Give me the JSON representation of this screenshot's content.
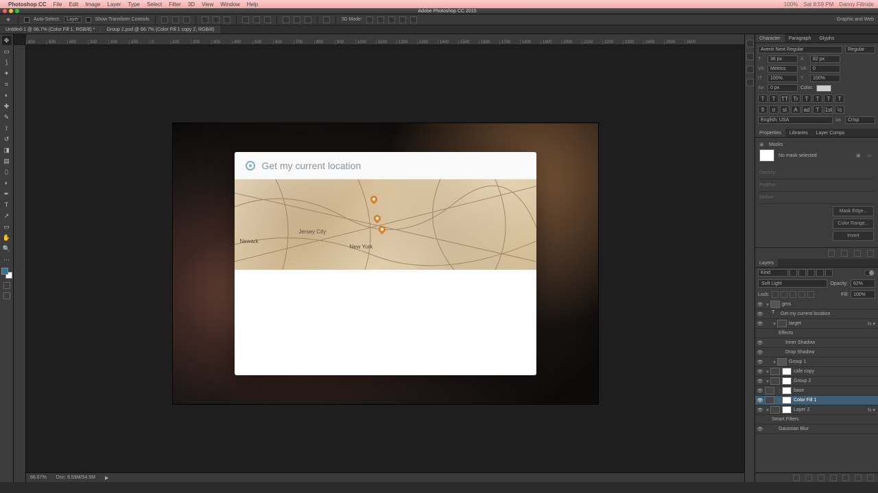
{
  "mac": {
    "app": "Photoshop CC",
    "menus": [
      "File",
      "Edit",
      "Image",
      "Layer",
      "Type",
      "Select",
      "Filter",
      "3D",
      "View",
      "Window",
      "Help"
    ],
    "right": [
      "100%",
      "Sat 8:59 PM",
      "Danny Filinide"
    ]
  },
  "window_title": "Adobe Photoshop CC 2015",
  "options": {
    "auto_select": "Auto-Select:",
    "auto_select_mode": "Layer",
    "show_transform": "Show Transform Controls",
    "threeD": "3D Mode:",
    "workspace": "Graphic and Web"
  },
  "tabs": [
    "Untitled-1 @ 66.7% (Color Fill 1, RGB/8) *",
    "Group 2.psd @ 66.7% (Color Fill 1 copy 2, RGB/8)"
  ],
  "ruler_marks": [
    "600",
    "500",
    "400",
    "300",
    "200",
    "100",
    "0",
    "100",
    "200",
    "300",
    "400",
    "500",
    "600",
    "700",
    "800",
    "900",
    "1000",
    "1100",
    "1200",
    "1300",
    "1400",
    "1500",
    "1600",
    "1700",
    "1800",
    "1900",
    "2000",
    "2100",
    "2200",
    "2300",
    "2400",
    "2500",
    "2600"
  ],
  "canvas": {
    "location_text": "Get my current location",
    "map_city": "New York",
    "map_city2": "Jersey City",
    "map_city3": "Newark"
  },
  "character": {
    "tabs": [
      "Character",
      "Paragraph",
      "Glyphs"
    ],
    "font": "Avenir Next Regular",
    "weight": "Regular",
    "size": "36 px",
    "leading": "82 px",
    "kerning": "Metrics",
    "tracking": "0",
    "vscale": "100%",
    "hscale": "100%",
    "baseline": "0 px",
    "color_label": "Color:",
    "lang": "English: USA",
    "aa": "Crisp",
    "style_btns": [
      "T",
      "T",
      "TT",
      "Tr",
      "T",
      "T",
      "T",
      "T"
    ],
    "ot_btns": [
      "fi",
      "σ",
      "st",
      "A",
      "ad",
      "T",
      "1st",
      "½"
    ]
  },
  "properties": {
    "tabs": [
      "Properties",
      "Libraries",
      "Layer Comps"
    ],
    "title": "Masks",
    "no_mask": "No mask selected",
    "density": "Density:",
    "feather": "Feather:",
    "refine": "Refine:",
    "mask_edge": "Mask Edge...",
    "color_range": "Color Range...",
    "invert": "Invert"
  },
  "layers": {
    "tab": "Layers",
    "kind": "Kind",
    "blend": "Soft Light",
    "opacity_label": "Opacity:",
    "opacity": "62%",
    "lock_label": "Lock:",
    "fill_label": "Fill:",
    "fill": "100%",
    "items": [
      {
        "name": "gms",
        "type": "folder",
        "indent": 0,
        "vis": true
      },
      {
        "name": "Get my current location",
        "type": "text",
        "indent": 1,
        "vis": true
      },
      {
        "name": "target",
        "type": "smart",
        "indent": 1,
        "vis": true,
        "fx": true
      },
      {
        "name": "Effects",
        "type": "label",
        "indent": 2,
        "vis": false
      },
      {
        "name": "Inner Shadow",
        "type": "effect",
        "indent": 3,
        "vis": true
      },
      {
        "name": "Drop Shadow",
        "type": "effect",
        "indent": 3,
        "vis": true
      },
      {
        "name": "Group 1",
        "type": "folder",
        "indent": 1,
        "vis": true
      },
      {
        "name": "cafe copy",
        "type": "smart",
        "indent": 0,
        "vis": true
      },
      {
        "name": "Group 2",
        "type": "smart",
        "indent": 0,
        "vis": true
      },
      {
        "name": "base",
        "type": "fill",
        "indent": 0,
        "vis": true
      },
      {
        "name": "Color Fill 1",
        "type": "fill",
        "indent": 0,
        "vis": true,
        "sel": true
      },
      {
        "name": "Layer 2",
        "type": "smart",
        "indent": 0,
        "vis": true,
        "fx": true
      },
      {
        "name": "Smart Filters",
        "type": "label",
        "indent": 1,
        "vis": false
      },
      {
        "name": "Gaussian Blur",
        "type": "effect",
        "indent": 2,
        "vis": true
      }
    ]
  },
  "status": {
    "zoom": "66.67%",
    "doc": "Doc: 6.59M/54.5M"
  }
}
